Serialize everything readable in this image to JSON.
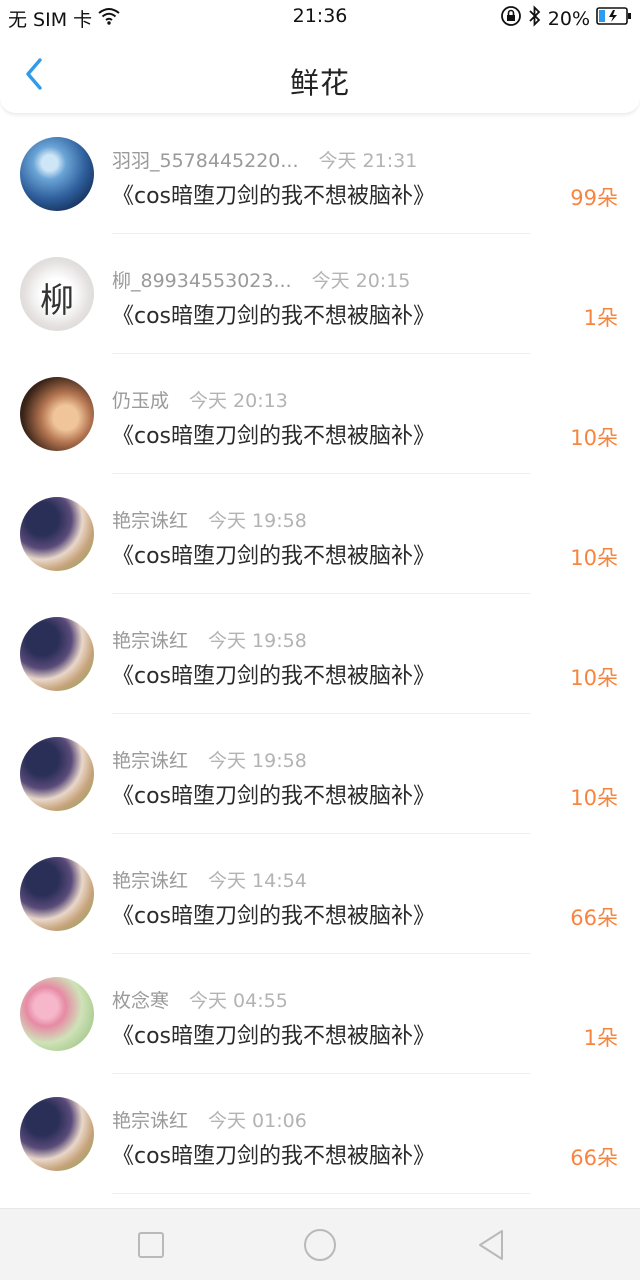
{
  "status_bar": {
    "carrier": "无 SIM 卡",
    "time": "21:36",
    "battery": "20%"
  },
  "header": {
    "title": "鲜花",
    "back_icon": "chevron-left-icon"
  },
  "items": [
    {
      "name": "羽羽_5578445220...",
      "time": "今天 21:31",
      "book": "《cos暗堕刀剑的我不想被脑补》",
      "count": "99朵"
    },
    {
      "name": "柳_89934553023...",
      "time": "今天 20:15",
      "book": "《cos暗堕刀剑的我不想被脑补》",
      "count": "1朵",
      "avatar_text": "柳"
    },
    {
      "name": "仍玉成",
      "time": "今天 20:13",
      "book": "《cos暗堕刀剑的我不想被脑补》",
      "count": "10朵"
    },
    {
      "name": "艳宗诛红",
      "time": "今天 19:58",
      "book": "《cos暗堕刀剑的我不想被脑补》",
      "count": "10朵"
    },
    {
      "name": "艳宗诛红",
      "time": "今天 19:58",
      "book": "《cos暗堕刀剑的我不想被脑补》",
      "count": "10朵"
    },
    {
      "name": "艳宗诛红",
      "time": "今天 19:58",
      "book": "《cos暗堕刀剑的我不想被脑补》",
      "count": "10朵"
    },
    {
      "name": "艳宗诛红",
      "time": "今天 14:54",
      "book": "《cos暗堕刀剑的我不想被脑补》",
      "count": "66朵"
    },
    {
      "name": "枚念寒",
      "time": "今天 04:55",
      "book": "《cos暗堕刀剑的我不想被脑补》",
      "count": "1朵"
    },
    {
      "name": "艳宗诛红",
      "time": "今天 01:06",
      "book": "《cos暗堕刀剑的我不想被脑补》",
      "count": "66朵"
    }
  ],
  "colors": {
    "accent": "#2f9bea",
    "count": "#f7853f"
  },
  "nav": {
    "recents_icon": "square-icon",
    "home_icon": "circle-icon",
    "back_icon": "triangle-back-icon"
  }
}
